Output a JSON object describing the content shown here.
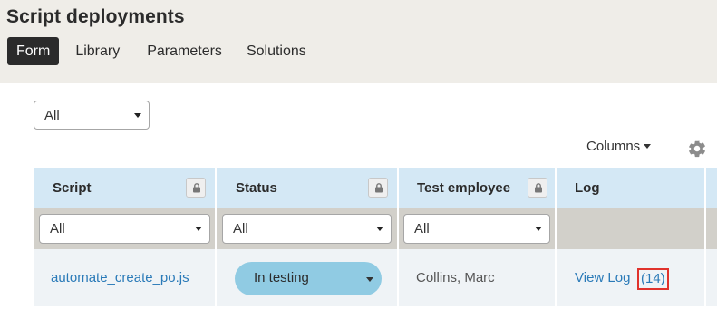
{
  "page": {
    "title": "Script deployments"
  },
  "tabs": [
    {
      "label": "Form",
      "active": true
    },
    {
      "label": "Library",
      "active": false
    },
    {
      "label": "Parameters",
      "active": false
    },
    {
      "label": "Solutions",
      "active": false
    }
  ],
  "filter": {
    "selected": "All"
  },
  "toolbar": {
    "columns_label": "Columns",
    "settings_icon": "gear-icon"
  },
  "grid": {
    "columns": [
      {
        "label": "Script",
        "lockable": true
      },
      {
        "label": "Status",
        "lockable": true
      },
      {
        "label": "Test employee",
        "lockable": true
      },
      {
        "label": "Log",
        "lockable": false
      }
    ],
    "column_filters": [
      "All",
      "All",
      "All"
    ],
    "rows": [
      {
        "script": "automate_create_po.js",
        "status": "In testing",
        "test_employee": "Collins, Marc",
        "log_label": "View Log",
        "log_count": "(14)"
      }
    ]
  },
  "colors": {
    "header_bg": "#d4e8f5",
    "filter_row_bg": "#d2d0ca",
    "status_pill": "#90cbe3",
    "link": "#2a7ab8",
    "highlight": "#e0322c",
    "topbar_bg": "#efede8"
  }
}
